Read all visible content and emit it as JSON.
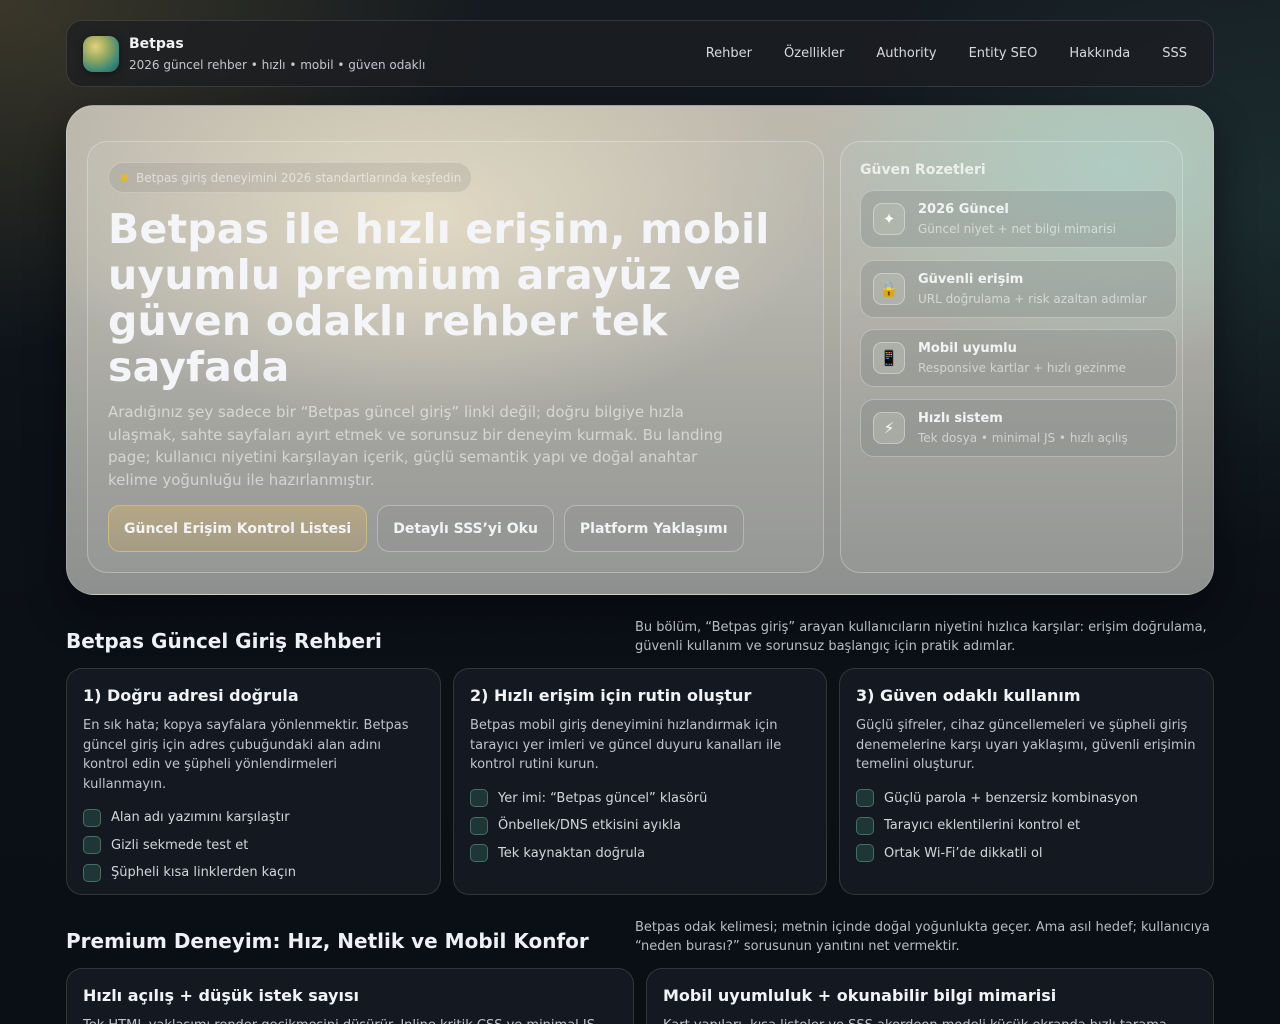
{
  "header": {
    "brand_name": "Betpas",
    "brand_tagline": "2026 güncel rehber • hızlı • mobil • güven odaklı",
    "nav": [
      "Rehber",
      "Özellikler",
      "Authority",
      "Entity SEO",
      "Hakkında",
      "SSS"
    ]
  },
  "hero": {
    "pill": "Betpas giriş deneyimini 2026 standartlarında keşfedin",
    "title": "Betpas ile hızlı erişim, mobil uyumlu premium arayüz ve güven odaklı rehber tek sayfada",
    "description": "Aradığınız şey sadece bir “Betpas güncel giriş” linki değil; doğru bilgiye hızla ulaşmak, sahte sayfaları ayırt etmek ve sorunsuz bir deneyim kurmak. Bu landing page; kullanıcı niyetini karşılayan içerik, güçlü semantik yapı ve doğal anahtar kelime yoğunluğu ile hazırlanmıştır.",
    "buttons": [
      "Güncel Erişim Kontrol Listesi",
      "Detaylı SSS’yi Oku",
      "Platform Yaklaşımı"
    ],
    "badges_title": "Güven Rozetleri",
    "badges": [
      {
        "icon": "sparkle-icon",
        "glyph": "✦",
        "title": "2026 Güncel",
        "subtitle": "Güncel niyet + net bilgi mimarisi"
      },
      {
        "icon": "lock-icon",
        "glyph": "🔒",
        "title": "Güvenli erişim",
        "subtitle": "URL doğrulama + risk azaltan adımlar"
      },
      {
        "icon": "mobile-icon",
        "glyph": "📱",
        "title": "Mobil uyumlu",
        "subtitle": "Responsive kartlar + hızlı gezinme"
      },
      {
        "icon": "lightning-icon",
        "glyph": "⚡",
        "title": "Hızlı sistem",
        "subtitle": "Tek dosya • minimal JS • hızlı açılış"
      }
    ]
  },
  "guide": {
    "title": "Betpas Güncel Giriş Rehberi",
    "note": "Bu bölüm, “Betpas giriş” arayan kullanıcıların niyetini hızlıca karşılar: erişim doğrulama, güvenli kullanım ve sorunsuz başlangıç için pratik adımlar.",
    "cards": [
      {
        "title": "1) Doğru adresi doğrula",
        "text": "En sık hata; kopya sayfalara yönlenmektir. Betpas güncel giriş için adres çubuğundaki alan adını kontrol edin ve şüpheli yönlendirmeleri kullanmayın.",
        "checks": [
          "Alan adı yazımını karşılaştır",
          "Gizli sekmede test et",
          "Şüpheli kısa linklerden kaçın"
        ]
      },
      {
        "title": "2) Hızlı erişim için rutin oluştur",
        "text": "Betpas mobil giriş deneyimini hızlandırmak için tarayıcı yer imleri ve güncel duyuru kanalları ile kontrol rutini kurun.",
        "checks": [
          "Yer imi: “Betpas güncel” klasörü",
          "Önbellek/DNS etkisini ayıkla",
          "Tek kaynaktan doğrula"
        ]
      },
      {
        "title": "3) Güven odaklı kullanım",
        "text": "Güçlü şifreler, cihaz güncellemeleri ve şüpheli giriş denemelerine karşı uyarı yaklaşımı, güvenli erişimin temelini oluşturur.",
        "checks": [
          "Güçlü parola + benzersiz kombinasyon",
          "Tarayıcı eklentilerini kontrol et",
          "Ortak Wi-Fi’de dikkatli ol"
        ]
      }
    ]
  },
  "premium": {
    "title": "Premium Deneyim: Hız, Netlik ve Mobil Konfor",
    "note": "Betpas odak kelimesi; metnin içinde doğal yoğunlukta geçer. Ama asıl hedef; kullanıcıya “neden burası?” sorusunun yanıtını net vermektir.",
    "cards": [
      {
        "title": "Hızlı açılış + düşük istek sayısı",
        "text": "Tek HTML yaklaşımı render gecikmesini düşürür. Inline kritik CSS ve minimal JS"
      },
      {
        "title": "Mobil uyumluluk + okunabilir bilgi mimarisi",
        "text": "Kart yapıları, kısa listeler ve SSS akordeon modeli küçük ekranda hızlı tarama"
      }
    ]
  }
}
